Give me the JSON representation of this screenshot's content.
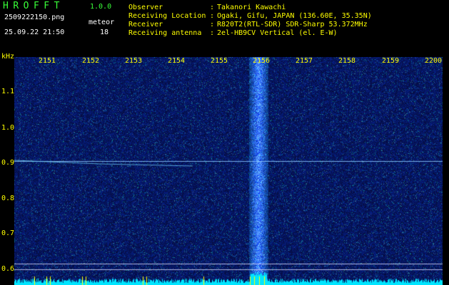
{
  "header": {
    "app_title": "HROFFT",
    "app_version": "1.0.0",
    "file_name": "2509222150.png",
    "meteor_label": "meteor",
    "date_time": "25.09.22 21:50",
    "meteor_count": "18"
  },
  "info": [
    {
      "key": "Observer",
      "value": "Takanori Kawachi"
    },
    {
      "key": "Receiving Location",
      "value": "Ogaki, Gifu, JAPAN (136.60E, 35.35N)"
    },
    {
      "key": "Receiver",
      "value": "R820T2(RTL-SDR) SDR-Sharp 53.372MHz"
    },
    {
      "key": "Receiving antenna",
      "value": "2el-HB9CV Vertical (el. E-W)"
    }
  ],
  "info_separator": ":",
  "axis": {
    "unit": "kHz",
    "freq_labels": [
      "2151",
      "2152",
      "2153",
      "2154",
      "2155",
      "2156",
      "2157",
      "2158",
      "2159",
      "2200"
    ],
    "khz_ticks": [
      "1.1",
      "1.0",
      "0.9",
      "0.8",
      "0.7",
      "0.6"
    ]
  },
  "colors": {
    "background": "#000000",
    "header_green": "#39ff39",
    "header_yellow": "#ffff00",
    "axis_yellow": "#ffff00",
    "spectrum_cyan": "#00e5ff",
    "signal_white": "#ffffff"
  }
}
